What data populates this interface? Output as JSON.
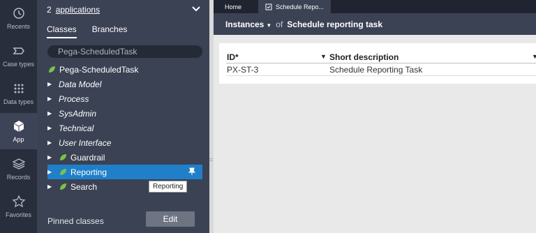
{
  "rail": {
    "items": [
      {
        "label": "Recents",
        "icon": "history-icon"
      },
      {
        "label": "Case types",
        "icon": "case-types-icon"
      },
      {
        "label": "Data types",
        "icon": "grid-dots-icon"
      },
      {
        "label": "App",
        "icon": "cube-icon",
        "active": true
      },
      {
        "label": "Records",
        "icon": "layers-icon"
      },
      {
        "label": "Favorites",
        "icon": "star-icon"
      }
    ]
  },
  "explorer": {
    "app_count": "2",
    "app_link": "applications",
    "tabs": [
      "Classes",
      "Branches"
    ],
    "active_tab": "Classes",
    "search_value": "Pega-ScheduledTask",
    "root": "Pega-ScheduledTask",
    "tree": [
      {
        "label": "Data Model",
        "italic": true,
        "leaf_icon": false
      },
      {
        "label": "Process",
        "italic": true,
        "leaf_icon": false
      },
      {
        "label": "SysAdmin",
        "italic": true,
        "leaf_icon": false
      },
      {
        "label": "Technical",
        "italic": true,
        "leaf_icon": false
      },
      {
        "label": "User Interface",
        "italic": true,
        "leaf_icon": false
      },
      {
        "label": "Guardrail",
        "italic": false,
        "leaf_icon": true
      },
      {
        "label": "Reporting",
        "italic": false,
        "leaf_icon": true,
        "selected": true
      },
      {
        "label": "Search",
        "italic": false,
        "leaf_icon": true
      }
    ],
    "tooltip": "Reporting",
    "pinned_label": "Pinned classes",
    "edit_label": "Edit"
  },
  "work": {
    "tabs": [
      "Home",
      "Schedule Repo..."
    ],
    "active_tab": "Schedule Repo...",
    "header": {
      "instances": "Instances",
      "of": "of",
      "title": "Schedule reporting task"
    },
    "table": {
      "columns": [
        "ID*",
        "Short description"
      ],
      "rows": [
        [
          "PX-ST-3",
          "Schedule Reporting Task"
        ]
      ]
    }
  },
  "colors": {
    "rail_bg": "#292e3d",
    "panel_bg": "#3b4254",
    "selected_bg": "#1f7fc9",
    "leaf_green": "#7cc24a"
  }
}
